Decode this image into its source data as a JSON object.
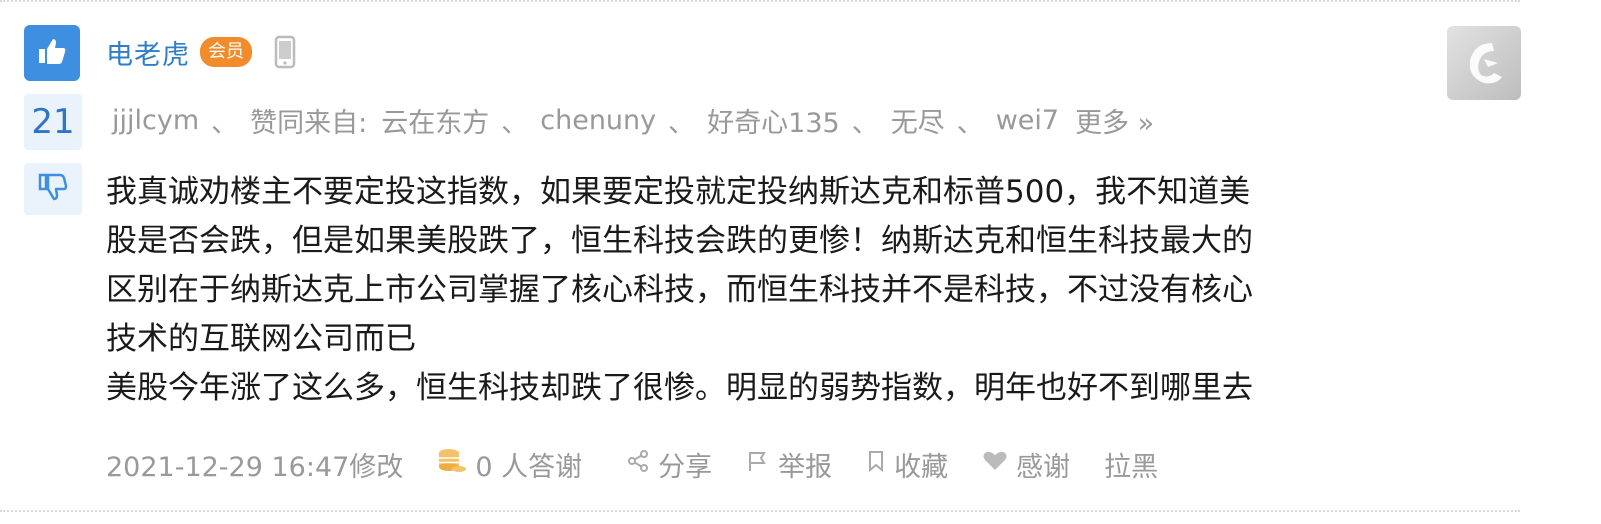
{
  "post": {
    "author": "电老虎",
    "badge": "会员",
    "like_count": "21",
    "likers_prefix": "jjjlcym",
    "liked_from_label": "赞同来自:",
    "likers": [
      "云在东方",
      "chenuny",
      "好奇心135",
      "无尽",
      "wei7"
    ],
    "separator": "、",
    "more_label": "更多 »",
    "content_lines": [
      "我真诚劝楼主不要定投这指数，如果要定投就定投纳斯达克和标普500，我不知道美",
      "股是否会跌，但是如果美股跌了，恒生科技会跌的更惨！纳斯达克和恒生科技最大的",
      "区别在于纳斯达克上市公司掌握了核心科技，而恒生科技并不是科技，不过没有核心",
      "技术的互联网公司而已",
      "美股今年涨了这么多，恒生科技却跌了很惨。明显的弱势指数，明年也好不到哪里去"
    ],
    "timestamp": "2021-12-29 16:47修改",
    "thanks_count": "0 人答谢",
    "share_label": "分享",
    "report_label": "举报",
    "favorite_label": "收藏",
    "thank_label": "感谢",
    "block_label": "拉黑"
  },
  "icons": {
    "like": "thumbs-up-icon",
    "dislike": "thumbs-down-icon",
    "device": "mobile-phone-icon",
    "coins": "coins-icon",
    "share": "share-icon",
    "report": "flag-icon",
    "favorite": "bookmark-icon",
    "thank": "heart-icon"
  },
  "colors": {
    "accent": "#3f8fe0",
    "username": "#2f7dc9",
    "badge": "#f28b2a",
    "muted": "#999999",
    "text": "#1a1a1a"
  }
}
